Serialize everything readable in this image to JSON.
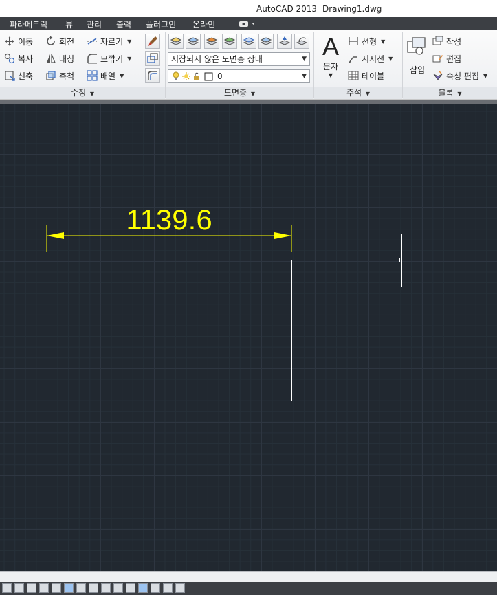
{
  "window": {
    "app_title": "AutoCAD 2013",
    "file_title": "Drawing1.dwg"
  },
  "menu": {
    "items": [
      "파라메트릭",
      "뷰",
      "관리",
      "출력",
      "플러그인",
      "온라인"
    ]
  },
  "ribbon": {
    "modify": {
      "title": "수정",
      "move": "이동",
      "rotate": "회전",
      "trim": "자르기",
      "copy": "복사",
      "mirror": "대칭",
      "fillet": "모깎기",
      "stretch": "신축",
      "scale": "축척",
      "array": "배열"
    },
    "layers": {
      "title": "도면층",
      "state_combo": "저장되지 않은 도면층 상태",
      "layer_combo": "0"
    },
    "annotation": {
      "title": "주석",
      "text": "문자",
      "linear": "선형",
      "leader": "지시선",
      "table": "테이블"
    },
    "block": {
      "title": "블록",
      "insert": "삽입",
      "create": "작성",
      "edit": "편집",
      "attr_edit": "속성 편집"
    }
  },
  "drawing": {
    "dimension_text": "1139.6",
    "dimension_color": "#ffff00",
    "rectangle_color": "#ffffff",
    "crosshair_color": "#ffffff"
  },
  "colors": {
    "canvas_bg": "#212830",
    "menubar_bg": "#3c3f44"
  }
}
